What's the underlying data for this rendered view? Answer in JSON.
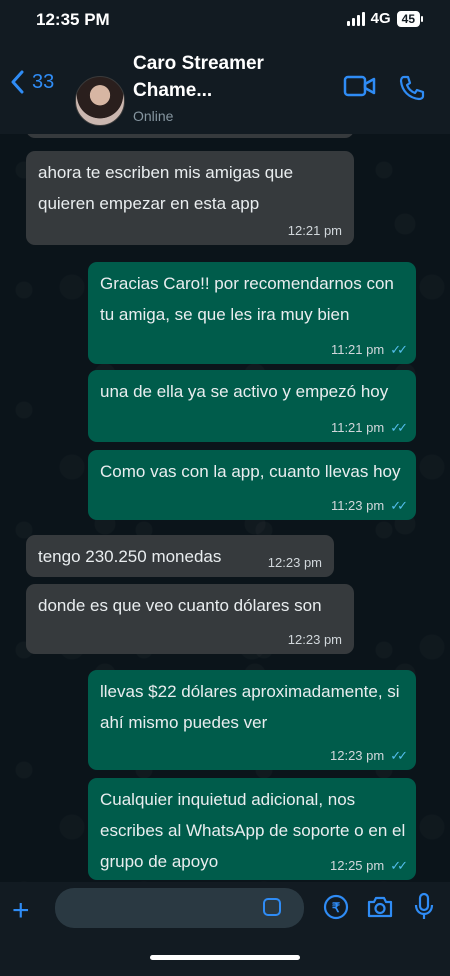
{
  "status": {
    "time": "12:35 PM",
    "network": "4G",
    "battery": "45"
  },
  "header": {
    "back_count": "33",
    "contact_name": "Caro Streamer Chame...",
    "presence": "Online"
  },
  "messages": [
    {
      "direction": "in",
      "text": "ahora te escriben mis amigas que quieren empezar en esta app",
      "time": "12:21 pm"
    },
    {
      "direction": "out",
      "text": "Gracias Caro!! por recomendarnos con tu amiga, se que les ira muy bien",
      "time": "11:21 pm",
      "read": true
    },
    {
      "direction": "out",
      "text": "una de ella ya se activo y empezó hoy",
      "time": "11:21 pm",
      "read": true
    },
    {
      "direction": "out",
      "text": "Como vas con la app, cuanto llevas hoy",
      "time": "11:23 pm",
      "read": true
    },
    {
      "direction": "in",
      "text": "tengo 230.250 monedas",
      "time": "12:23 pm"
    },
    {
      "direction": "in",
      "text": "donde es que veo cuanto dólares son",
      "time": "12:23 pm"
    },
    {
      "direction": "out",
      "text": "llevas $22 dólares aproximadamente, si ahí mismo puedes ver",
      "time": "12:23 pm",
      "read": true
    },
    {
      "direction": "out",
      "text": "Cualquier inquietud adicional, nos escribes al WhatsApp de soporte o en el grupo de apoyo",
      "time": "12:25 pm",
      "read": true
    }
  ],
  "composer": {
    "placeholder": ""
  },
  "colors": {
    "accent": "#2f8cf5",
    "incoming_bubble": "#363a3d",
    "outgoing_bubble": "#005c4b",
    "read_ticks": "#53bdeb",
    "background": "#0b141a"
  },
  "icons": [
    "back-chevron-icon",
    "video-call-icon",
    "phone-call-icon",
    "plus-icon",
    "sticker-icon",
    "payment-icon",
    "camera-icon",
    "microphone-icon"
  ]
}
